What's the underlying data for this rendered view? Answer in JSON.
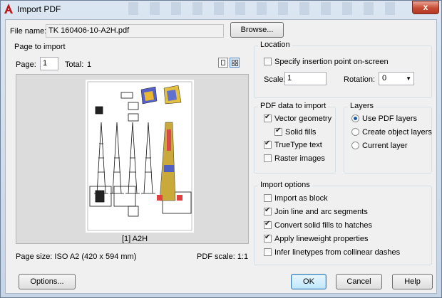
{
  "window": {
    "title": "Import PDF",
    "close_glyph": "x"
  },
  "file": {
    "label": "File name:",
    "value": "TK 160406-10-A2H.pdf",
    "browse_label": "Browse..."
  },
  "page_to_import": {
    "heading": "Page to import",
    "page_label": "Page:",
    "page_value": "1",
    "total_label": "Total:",
    "total_value": "1",
    "thumbnail_caption": "[1] A2H",
    "page_size": "Page size: ISO A2 (420 x 594 mm)",
    "pdf_scale": "PDF scale: 1:1"
  },
  "location": {
    "heading": "Location",
    "specify_onscreen": {
      "label": "Specify insertion point on-screen",
      "checked": false
    },
    "scale_label": "Scale:",
    "scale_value": "1",
    "rotation_label": "Rotation:",
    "rotation_value": "0"
  },
  "pdf_data": {
    "heading": "PDF data to import",
    "items": [
      {
        "label": "Vector geometry",
        "checked": true
      },
      {
        "label": "Solid fills",
        "checked": true
      },
      {
        "label": "TrueType text",
        "checked": true
      },
      {
        "label": "Raster images",
        "checked": false
      }
    ]
  },
  "layers": {
    "heading": "Layers",
    "options": [
      {
        "label": "Use PDF layers",
        "selected": true
      },
      {
        "label": "Create object layers",
        "selected": false
      },
      {
        "label": "Current layer",
        "selected": false
      }
    ]
  },
  "import_options": {
    "heading": "Import options",
    "items": [
      {
        "label": "Import as block",
        "checked": false
      },
      {
        "label": "Join line and arc segments",
        "checked": true
      },
      {
        "label": "Convert solid fills to hatches",
        "checked": true
      },
      {
        "label": "Apply lineweight properties",
        "checked": true
      },
      {
        "label": "Infer linetypes from collinear dashes",
        "checked": false
      }
    ]
  },
  "buttons": {
    "options": "Options...",
    "ok": "OK",
    "cancel": "Cancel",
    "help": "Help"
  },
  "colors": {
    "accent": "#3c7fb1",
    "client_bg": "#f0f0f0",
    "logo_red": "#c0191a"
  }
}
